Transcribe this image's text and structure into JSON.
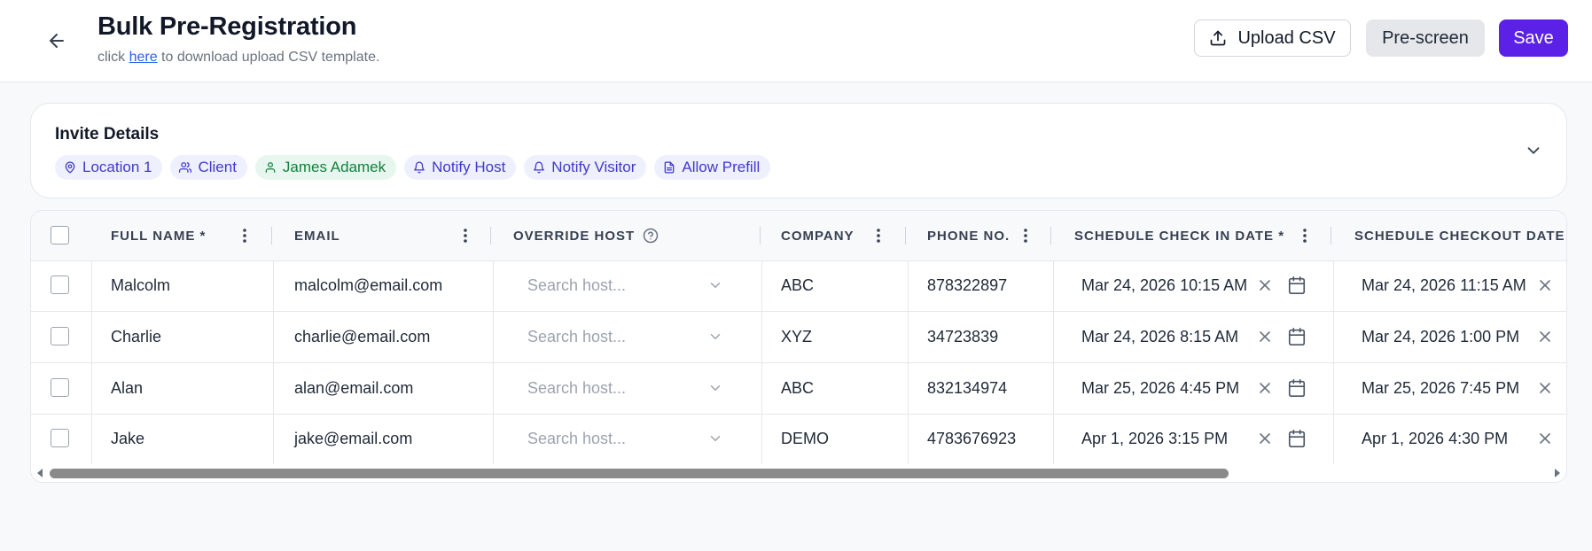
{
  "header": {
    "title": "Bulk Pre-Registration",
    "subtitle_prefix": "click ",
    "subtitle_link": "here",
    "subtitle_suffix": " to download upload CSV template.",
    "upload_label": "Upload CSV",
    "prescreen_label": "Pre-screen",
    "save_label": "Save"
  },
  "invite": {
    "title": "Invite Details",
    "chips": [
      {
        "label": "Location 1",
        "icon": "pin-icon"
      },
      {
        "label": "Client",
        "icon": "users-icon"
      },
      {
        "label": "James Adamek",
        "icon": "user-icon"
      },
      {
        "label": "Notify Host",
        "icon": "bell-icon"
      },
      {
        "label": "Notify Visitor",
        "icon": "bell-icon"
      },
      {
        "label": "Allow Prefill",
        "icon": "document-icon"
      }
    ]
  },
  "table": {
    "columns": {
      "full_name": "FULL NAME *",
      "email": "EMAIL",
      "override_host": "OVERRIDE HOST",
      "company": "COMPANY",
      "phone": "PHONE NO.",
      "checkin": "SCHEDULE CHECK IN DATE *",
      "checkout": "SCHEDULE CHECKOUT DATE"
    },
    "host_placeholder": "Search host...",
    "rows": [
      {
        "name": "Malcolm",
        "email": "malcolm@email.com",
        "company": "ABC",
        "phone": "878322897",
        "checkin": "Mar 24, 2026 10:15 AM",
        "checkout": "Mar 24, 2026 11:15 AM"
      },
      {
        "name": "Charlie",
        "email": "charlie@email.com",
        "company": "XYZ",
        "phone": "34723839",
        "checkin": "Mar 24, 2026 8:15 AM",
        "checkout": "Mar 24, 2026 1:00 PM"
      },
      {
        "name": "Alan",
        "email": "alan@email.com",
        "company": "ABC",
        "phone": "832134974",
        "checkin": "Mar 25, 2026 4:45 PM",
        "checkout": "Mar 25, 2026 7:45 PM"
      },
      {
        "name": "Jake",
        "email": "jake@email.com",
        "company": "DEMO",
        "phone": "4783676923",
        "checkin": "Apr 1, 2026 3:15 PM",
        "checkout": "Apr 1, 2026 4:30 PM"
      }
    ]
  },
  "colors": {
    "accent": "#5b21e6",
    "chip_bg": "#eef0fd",
    "chip_text": "#4338ca",
    "chip_green_bg": "#e7f6ee",
    "chip_green_text": "#15803d"
  }
}
